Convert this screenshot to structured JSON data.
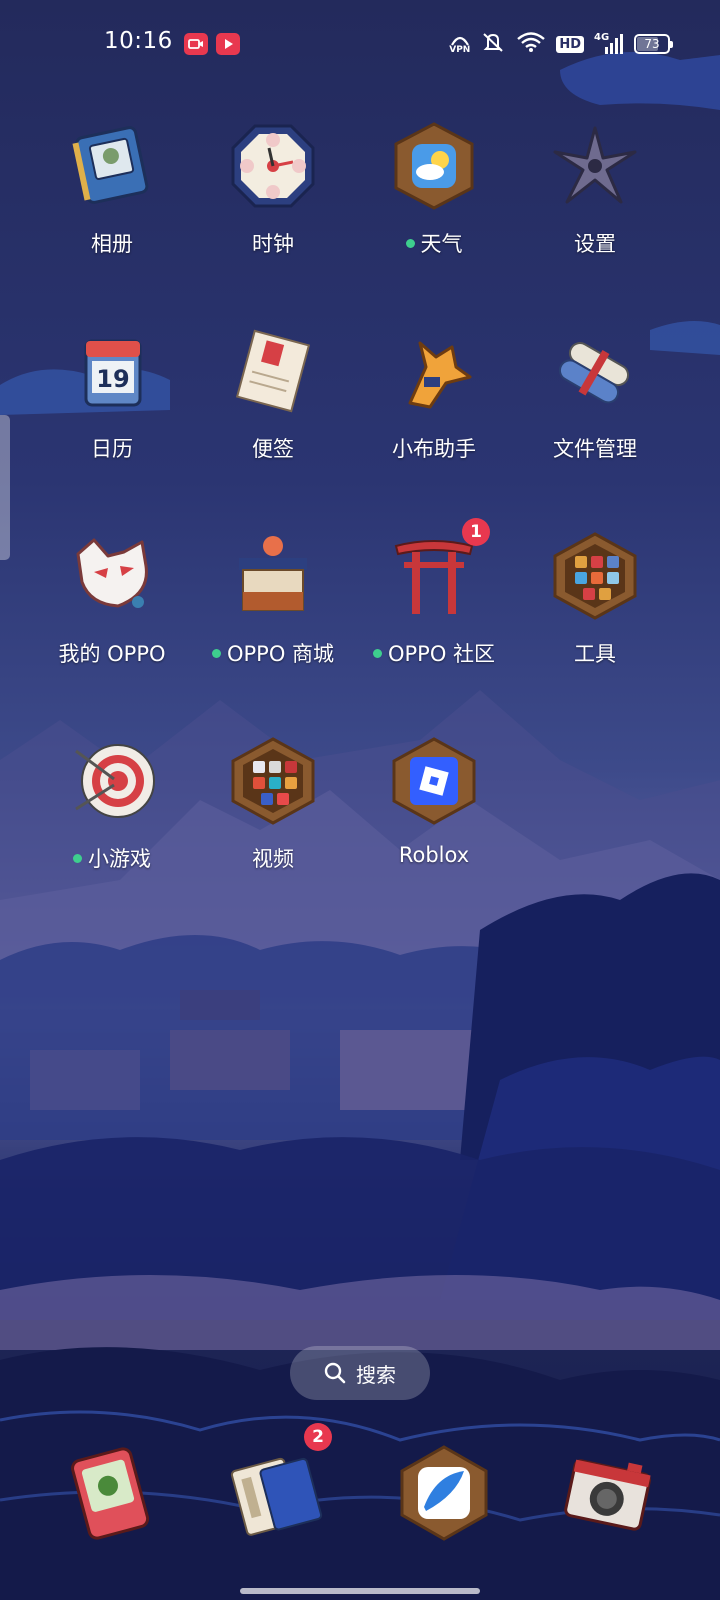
{
  "status_bar": {
    "time": "10:16",
    "vpn_label": "VPN",
    "hd_label": "HD",
    "network_label": "4G",
    "battery": "73"
  },
  "apps": [
    {
      "label": "相册",
      "icon": "photo-album-icon",
      "dot": false
    },
    {
      "label": "时钟",
      "icon": "clock-icon",
      "dot": false
    },
    {
      "label": "天气",
      "icon": "weather-icon",
      "dot": true
    },
    {
      "label": "设置",
      "icon": "settings-shuriken-icon",
      "dot": false
    },
    {
      "label": "日历",
      "icon": "calendar-icon",
      "dot": false,
      "icon_text": "19"
    },
    {
      "label": "便签",
      "icon": "notes-icon",
      "dot": false
    },
    {
      "label": "小布助手",
      "icon": "assistant-fox-icon",
      "dot": false
    },
    {
      "label": "文件管理",
      "icon": "file-scroll-icon",
      "dot": false
    },
    {
      "label": "我的 OPPO",
      "icon": "fox-mask-icon",
      "dot": false
    },
    {
      "label": "OPPO 商城",
      "icon": "shop-stall-icon",
      "dot": true
    },
    {
      "label": "OPPO 社区",
      "icon": "torii-gate-icon",
      "dot": true,
      "badge": "1"
    },
    {
      "label": "工具",
      "icon": "tools-folder-icon",
      "dot": false
    },
    {
      "label": "小游戏",
      "icon": "target-icon",
      "dot": true
    },
    {
      "label": "视频",
      "icon": "video-folder-icon",
      "dot": false
    },
    {
      "label": "Roblox",
      "icon": "roblox-icon",
      "dot": false
    }
  ],
  "search": {
    "label": "搜索"
  },
  "dock": [
    {
      "icon": "phone-icon"
    },
    {
      "icon": "messages-icon",
      "badge": "2"
    },
    {
      "icon": "browser-icon"
    },
    {
      "icon": "camera-icon"
    }
  ],
  "colors": {
    "badge": "#e8384f",
    "dot": "#3ecf8e",
    "frame": "#8a5a2f"
  }
}
